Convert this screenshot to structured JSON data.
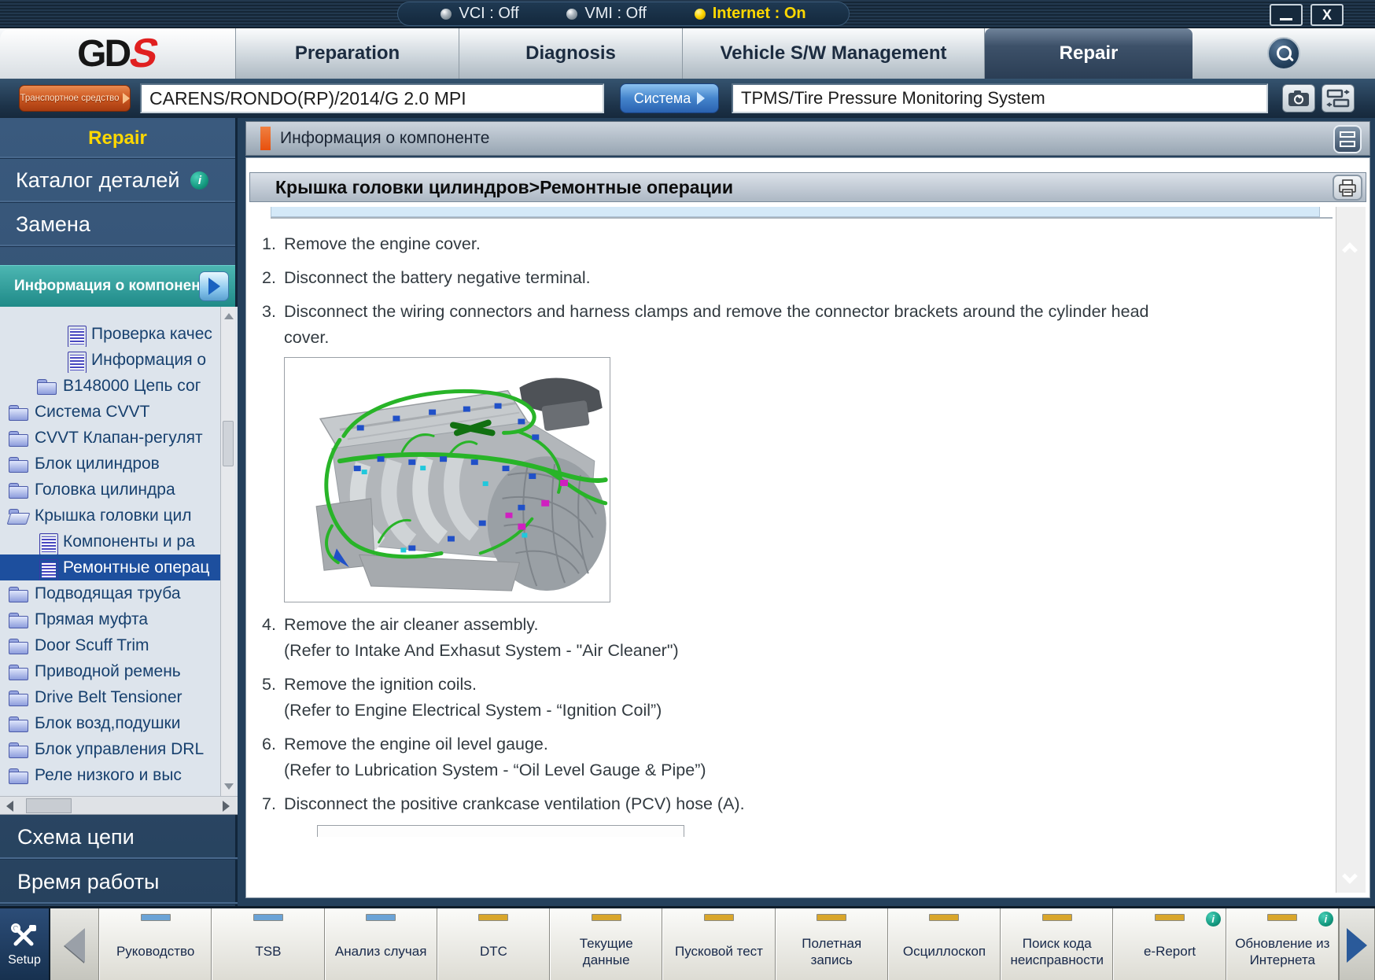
{
  "colors": {
    "internet": "#ffd800",
    "accent": "#e8500e",
    "teal": "#1f8a88",
    "selected": "#1d4f9e",
    "ind_blue": "#6ba3d6",
    "ind_yellow": "#d9a62b",
    "logo_red": "#e02020"
  },
  "titlebar": {
    "vci": "VCI : Off",
    "vmi": "VMI : Off",
    "internet": "Internet : On",
    "close": "X"
  },
  "header": {
    "logo_gd": "GD",
    "logo_s": "S",
    "tabs": [
      {
        "label": "Preparation",
        "active": false
      },
      {
        "label": "Diagnosis",
        "active": false
      },
      {
        "label": "Vehicle S/W Management",
        "active": false
      },
      {
        "label": "Repair",
        "active": true
      }
    ]
  },
  "vehicle_bar": {
    "vehicle_button": "Транспортное средство",
    "vehicle_value": "CARENS/RONDO(RP)/2014/G 2.0 MPI",
    "system_button": "Система",
    "system_value": "TPMS/Tire Pressure Monitoring System"
  },
  "sidebar": {
    "section_title": "Repair",
    "info_glyph": "i",
    "menu": [
      {
        "label": "Каталог деталей",
        "info": true
      },
      {
        "label": "Замена",
        "info": false
      }
    ],
    "active_menu": "Информация о компоненте",
    "tree": [
      {
        "icon": "doc",
        "label": "Проверка качес",
        "indent": 2,
        "selected": false
      },
      {
        "icon": "doc",
        "label": "Информация о",
        "indent": 2,
        "selected": false
      },
      {
        "icon": "folder",
        "label": "B148000 Цепь сог",
        "indent": 1,
        "selected": false
      },
      {
        "icon": "folder",
        "label": "Система CVVT",
        "indent": 0,
        "selected": false
      },
      {
        "icon": "folder",
        "label": "CVVT Клапан-регулят",
        "indent": 0,
        "selected": false
      },
      {
        "icon": "folder",
        "label": "Блок цилиндров",
        "indent": 0,
        "selected": false
      },
      {
        "icon": "folder",
        "label": "Головка цилиндра",
        "indent": 0,
        "selected": false
      },
      {
        "icon": "folder-open",
        "label": "Крышка головки цил",
        "indent": 0,
        "selected": false
      },
      {
        "icon": "doc",
        "label": "Компоненты и ра",
        "indent": 1,
        "selected": false
      },
      {
        "icon": "doc",
        "label": "Ремонтные операц",
        "indent": 1,
        "selected": true
      },
      {
        "icon": "folder",
        "label": "Подводящая труба",
        "indent": 0,
        "selected": false
      },
      {
        "icon": "folder",
        "label": "Прямая муфта",
        "indent": 0,
        "selected": false
      },
      {
        "icon": "folder",
        "label": "Door Scuff Trim",
        "indent": 0,
        "selected": false
      },
      {
        "icon": "folder",
        "label": "Приводной ремень",
        "indent": 0,
        "selected": false
      },
      {
        "icon": "folder",
        "label": "Drive Belt Tensioner",
        "indent": 0,
        "selected": false
      },
      {
        "icon": "folder",
        "label": "Блок возд,подушки",
        "indent": 0,
        "selected": false
      },
      {
        "icon": "folder",
        "label": "Блок управления DRL",
        "indent": 0,
        "selected": false
      },
      {
        "icon": "folder",
        "label": "Реле низкого и выс",
        "indent": 0,
        "selected": false
      }
    ],
    "footer": [
      "Схема цепи",
      "Время работы"
    ]
  },
  "content": {
    "panel_title": "Информация о компоненте",
    "doc_title": "Крышка головки цилиндров>Ремонтные операции",
    "steps": [
      {
        "num": "1.",
        "text": "Remove the engine cover."
      },
      {
        "num": "2.",
        "text": "Disconnect the battery negative terminal."
      },
      {
        "num": "3.",
        "text": "Disconnect the wiring connectors and harness clamps and remove the connector brackets around the cylinder head cover.",
        "figure": "engine"
      },
      {
        "num": "4.",
        "text": "Remove the air cleaner assembly.",
        "refer": "(Refer to Intake And Exhasut System - \"Air Cleaner\")"
      },
      {
        "num": "5.",
        "text": "Remove the ignition coils.",
        "refer": "(Refer to Engine Electrical System - “Ignition Coil”)"
      },
      {
        "num": "6.",
        "text": "Remove the engine oil level gauge.",
        "refer": "(Refer to Lubrication System - “Oil Level Gauge & Pipe”)"
      },
      {
        "num": "7.",
        "text": "Disconnect the positive crankcase ventilation (PCV) hose (A).",
        "figure": "partial"
      }
    ]
  },
  "toolbar": {
    "setup_label": "Setup",
    "info_glyph": "i",
    "buttons": [
      {
        "label": "Руководство",
        "indicator": "blue",
        "info": false
      },
      {
        "label": "TSB",
        "indicator": "blue",
        "info": false
      },
      {
        "label": "Анализ случая",
        "indicator": "blue",
        "info": false
      },
      {
        "label": "DTC",
        "indicator": "yellow",
        "info": false
      },
      {
        "label": "Текущие данные",
        "indicator": "yellow",
        "info": false
      },
      {
        "label": "Пусковой тест",
        "indicator": "yellow",
        "info": false
      },
      {
        "label": "Полетная запись",
        "indicator": "yellow",
        "info": false
      },
      {
        "label": "Осциллоскоп",
        "indicator": "yellow",
        "info": false
      },
      {
        "label": "Поиск кода неисправности",
        "indicator": "yellow",
        "info": false
      },
      {
        "label": "e-Report",
        "indicator": "yellow",
        "info": true
      },
      {
        "label": "Обновление из Интернета",
        "indicator": "yellow",
        "info": true
      }
    ]
  }
}
